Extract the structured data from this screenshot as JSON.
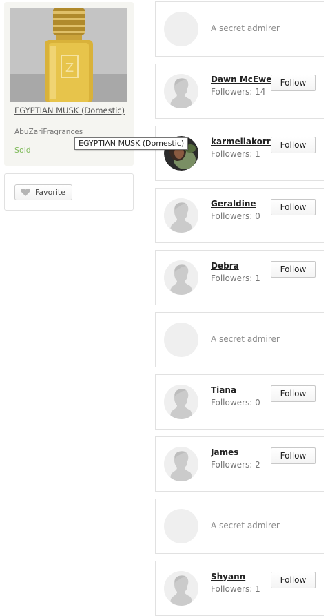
{
  "listing": {
    "title": "EGYPTIAN MUSK (Domestic)",
    "shop": "AbuZariFragrances",
    "status": "Sold",
    "image_icon": "perfume-bottle-image"
  },
  "favorite": {
    "label": "Favorite",
    "icon": "heart-icon"
  },
  "tooltip": {
    "text": "EGYPTIAN MUSK (Domestic)"
  },
  "followers": [
    {
      "type": "admirer",
      "text": "A secret admirer"
    },
    {
      "type": "user",
      "name": "Dawn McEwen",
      "followers": "Followers: 14",
      "button": "Follow"
    },
    {
      "type": "user",
      "name": "karmellakorrin",
      "followers": "Followers: 1",
      "button": "Follow",
      "photo": true
    },
    {
      "type": "user",
      "name": "Geraldine",
      "followers": "Followers: 0",
      "button": "Follow"
    },
    {
      "type": "user",
      "name": "Debra",
      "followers": "Followers: 1",
      "button": "Follow"
    },
    {
      "type": "admirer",
      "text": "A secret admirer"
    },
    {
      "type": "user",
      "name": "Tiana",
      "followers": "Followers: 0",
      "button": "Follow"
    },
    {
      "type": "user",
      "name": "James",
      "followers": "Followers: 2",
      "button": "Follow"
    },
    {
      "type": "admirer",
      "text": "A secret admirer"
    },
    {
      "type": "user",
      "name": "Shyann",
      "followers": "Followers: 1",
      "button": "Follow"
    }
  ],
  "colors": {
    "sold": "#7fba5a",
    "card_border": "#e1e1e1",
    "placeholder_avatar": "#efefef"
  }
}
